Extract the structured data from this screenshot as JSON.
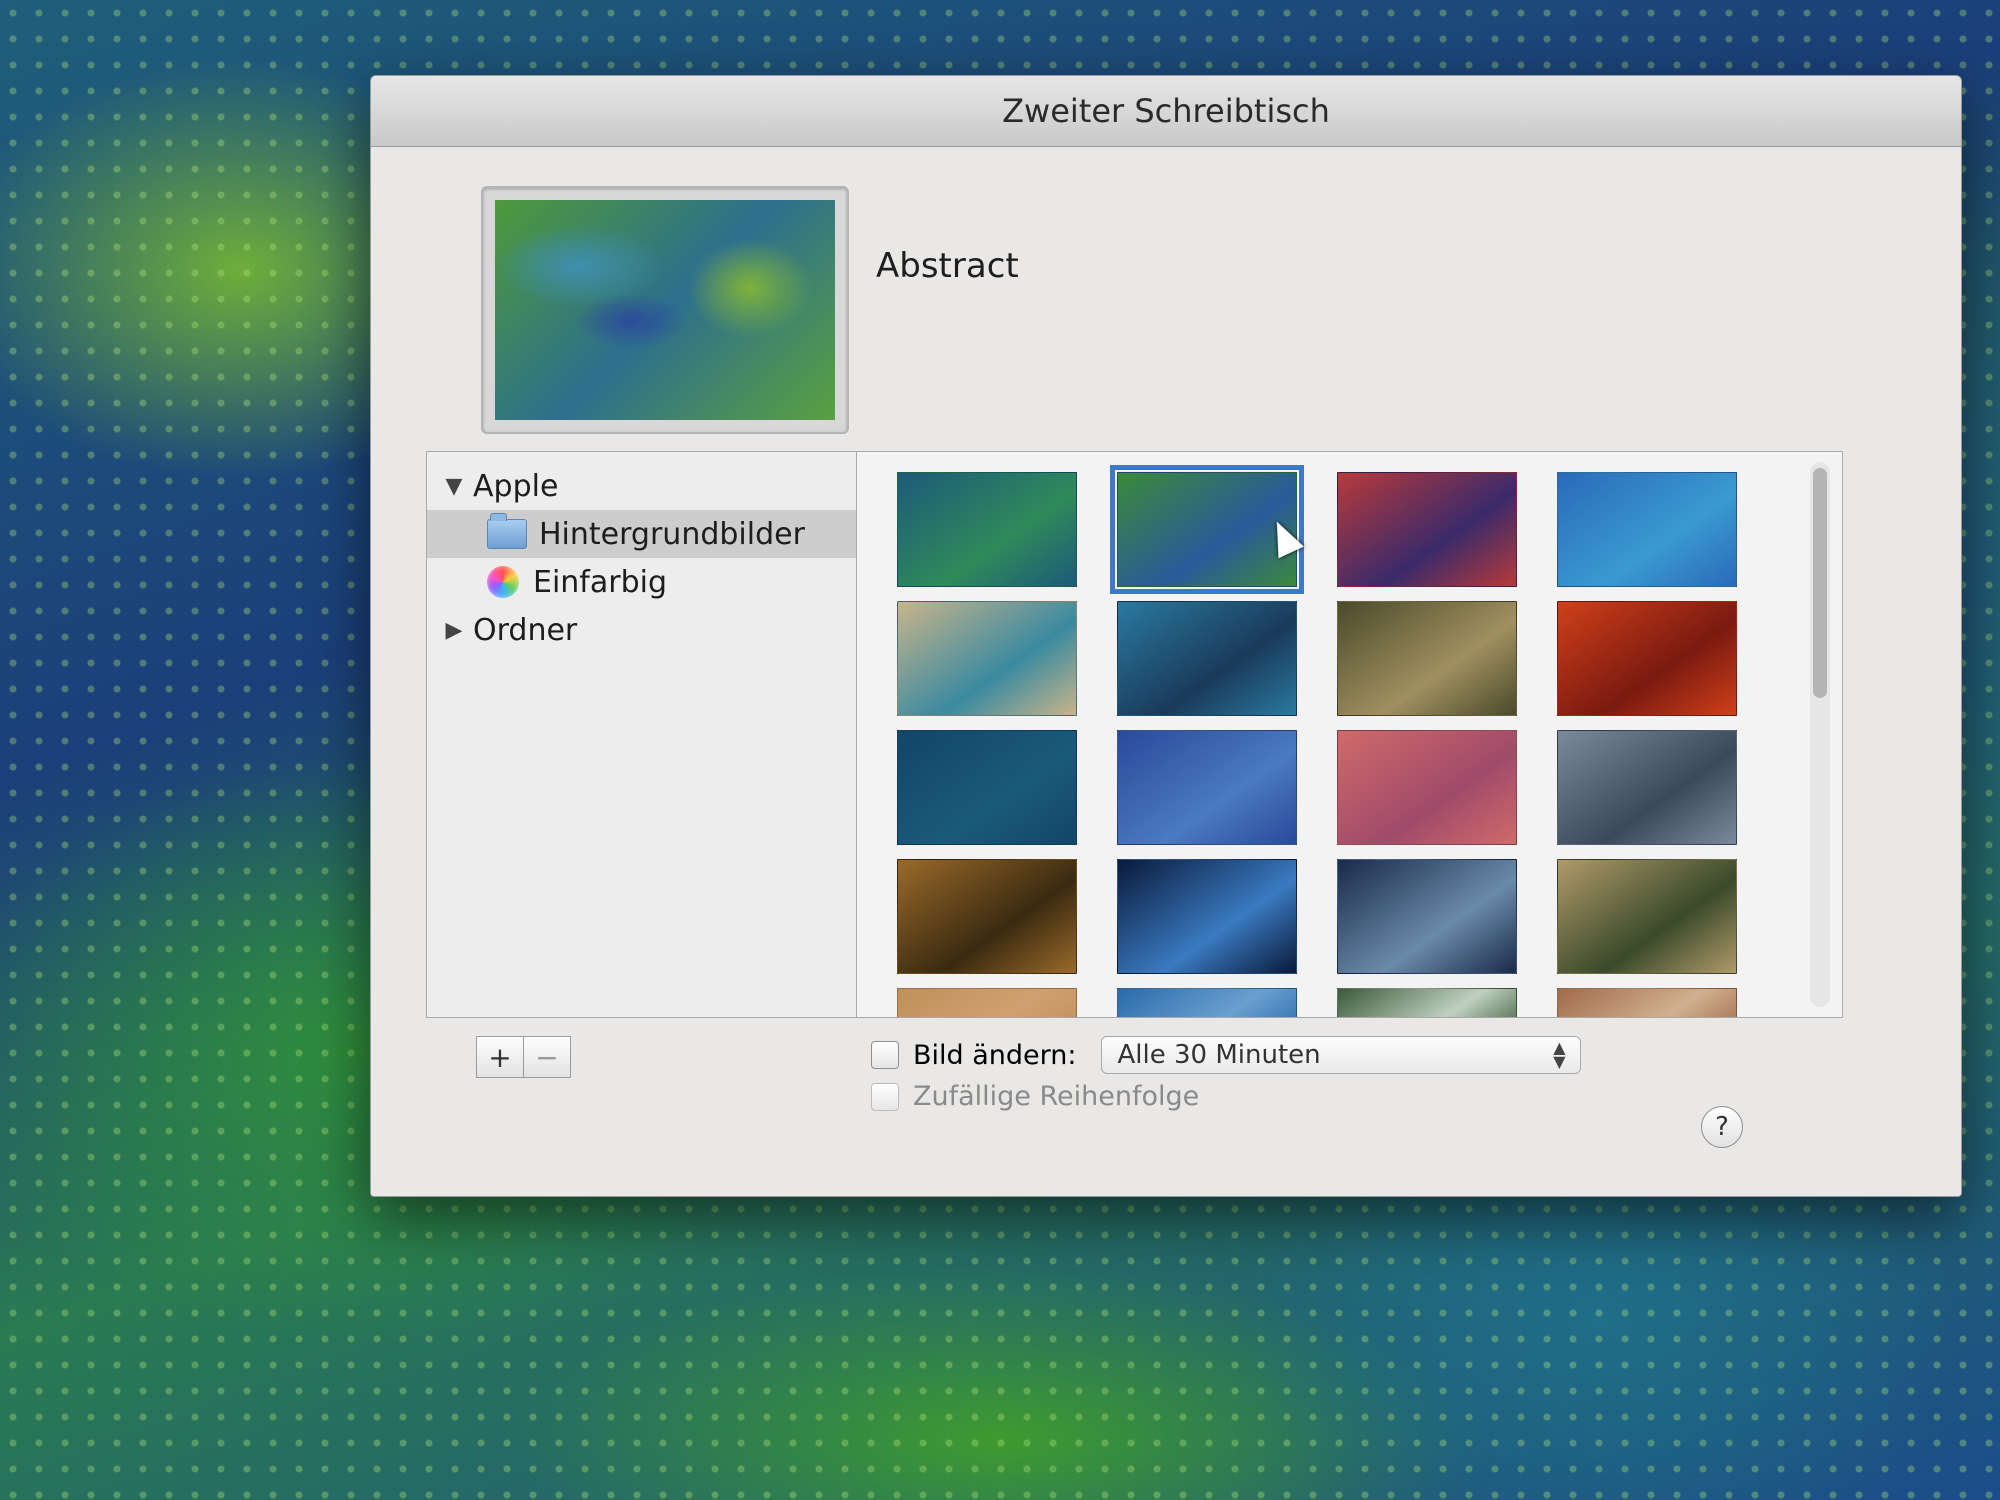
{
  "window": {
    "title": "Zweiter Schreibtisch"
  },
  "preview": {
    "name": "Abstract"
  },
  "sidebar": {
    "items": [
      {
        "label": "Apple",
        "disclosure": "▼",
        "icon": "none"
      },
      {
        "label": "Hintergrundbilder",
        "disclosure": "",
        "icon": "folder-icon",
        "selected": true
      },
      {
        "label": "Einfarbig",
        "disclosure": "",
        "icon": "color-wheel-icon"
      },
      {
        "label": "Ordner",
        "disclosure": "▶",
        "icon": "none"
      }
    ]
  },
  "thumbnails": [
    {
      "color": "#1d5a7a",
      "accent": "#2f8a5a"
    },
    {
      "color": "#3a8a3a",
      "accent": "#2a5a9a",
      "selected": true
    },
    {
      "color": "#b83a3a",
      "accent": "#3a2a6a"
    },
    {
      "color": "#2a6aba",
      "accent": "#3a9ad0"
    },
    {
      "color": "#c8b48a",
      "accent": "#3a8aa0"
    },
    {
      "color": "#2a7aa0",
      "accent": "#1a3a5a"
    },
    {
      "color": "#4a4a2a",
      "accent": "#a09060"
    },
    {
      "color": "#d0401a",
      "accent": "#7a1a10"
    },
    {
      "color": "#12456a",
      "accent": "#1a5a7a"
    },
    {
      "color": "#2a4a9a",
      "accent": "#4a7ac0"
    },
    {
      "color": "#d06a6a",
      "accent": "#a04a6a"
    },
    {
      "color": "#7a8a9a",
      "accent": "#3a4a5a"
    },
    {
      "color": "#9a6a2a",
      "accent": "#3a2a10"
    },
    {
      "color": "#0a1a3a",
      "accent": "#3a7ac0"
    },
    {
      "color": "#1a2a4a",
      "accent": "#6a8aaa"
    },
    {
      "color": "#b09a6a",
      "accent": "#3a4a2a"
    },
    {
      "color": "#c0905a",
      "accent": "#d0a070",
      "partial": true
    },
    {
      "color": "#2a6aaa",
      "accent": "#6aa0d0",
      "partial": true
    },
    {
      "color": "#3a5a3a",
      "accent": "#c0d0c0",
      "partial": true
    },
    {
      "color": "#a06a4a",
      "accent": "#d0b090",
      "partial": true
    }
  ],
  "list_buttons": {
    "add": "+",
    "remove": "−"
  },
  "options": {
    "change_picture_label": "Bild ändern:",
    "interval_value": "Alle 30 Minuten",
    "random_order_label": "Zufällige Reihenfolge"
  },
  "help": {
    "label": "?"
  },
  "colors": {
    "selection_outline": "#3d78c9"
  }
}
